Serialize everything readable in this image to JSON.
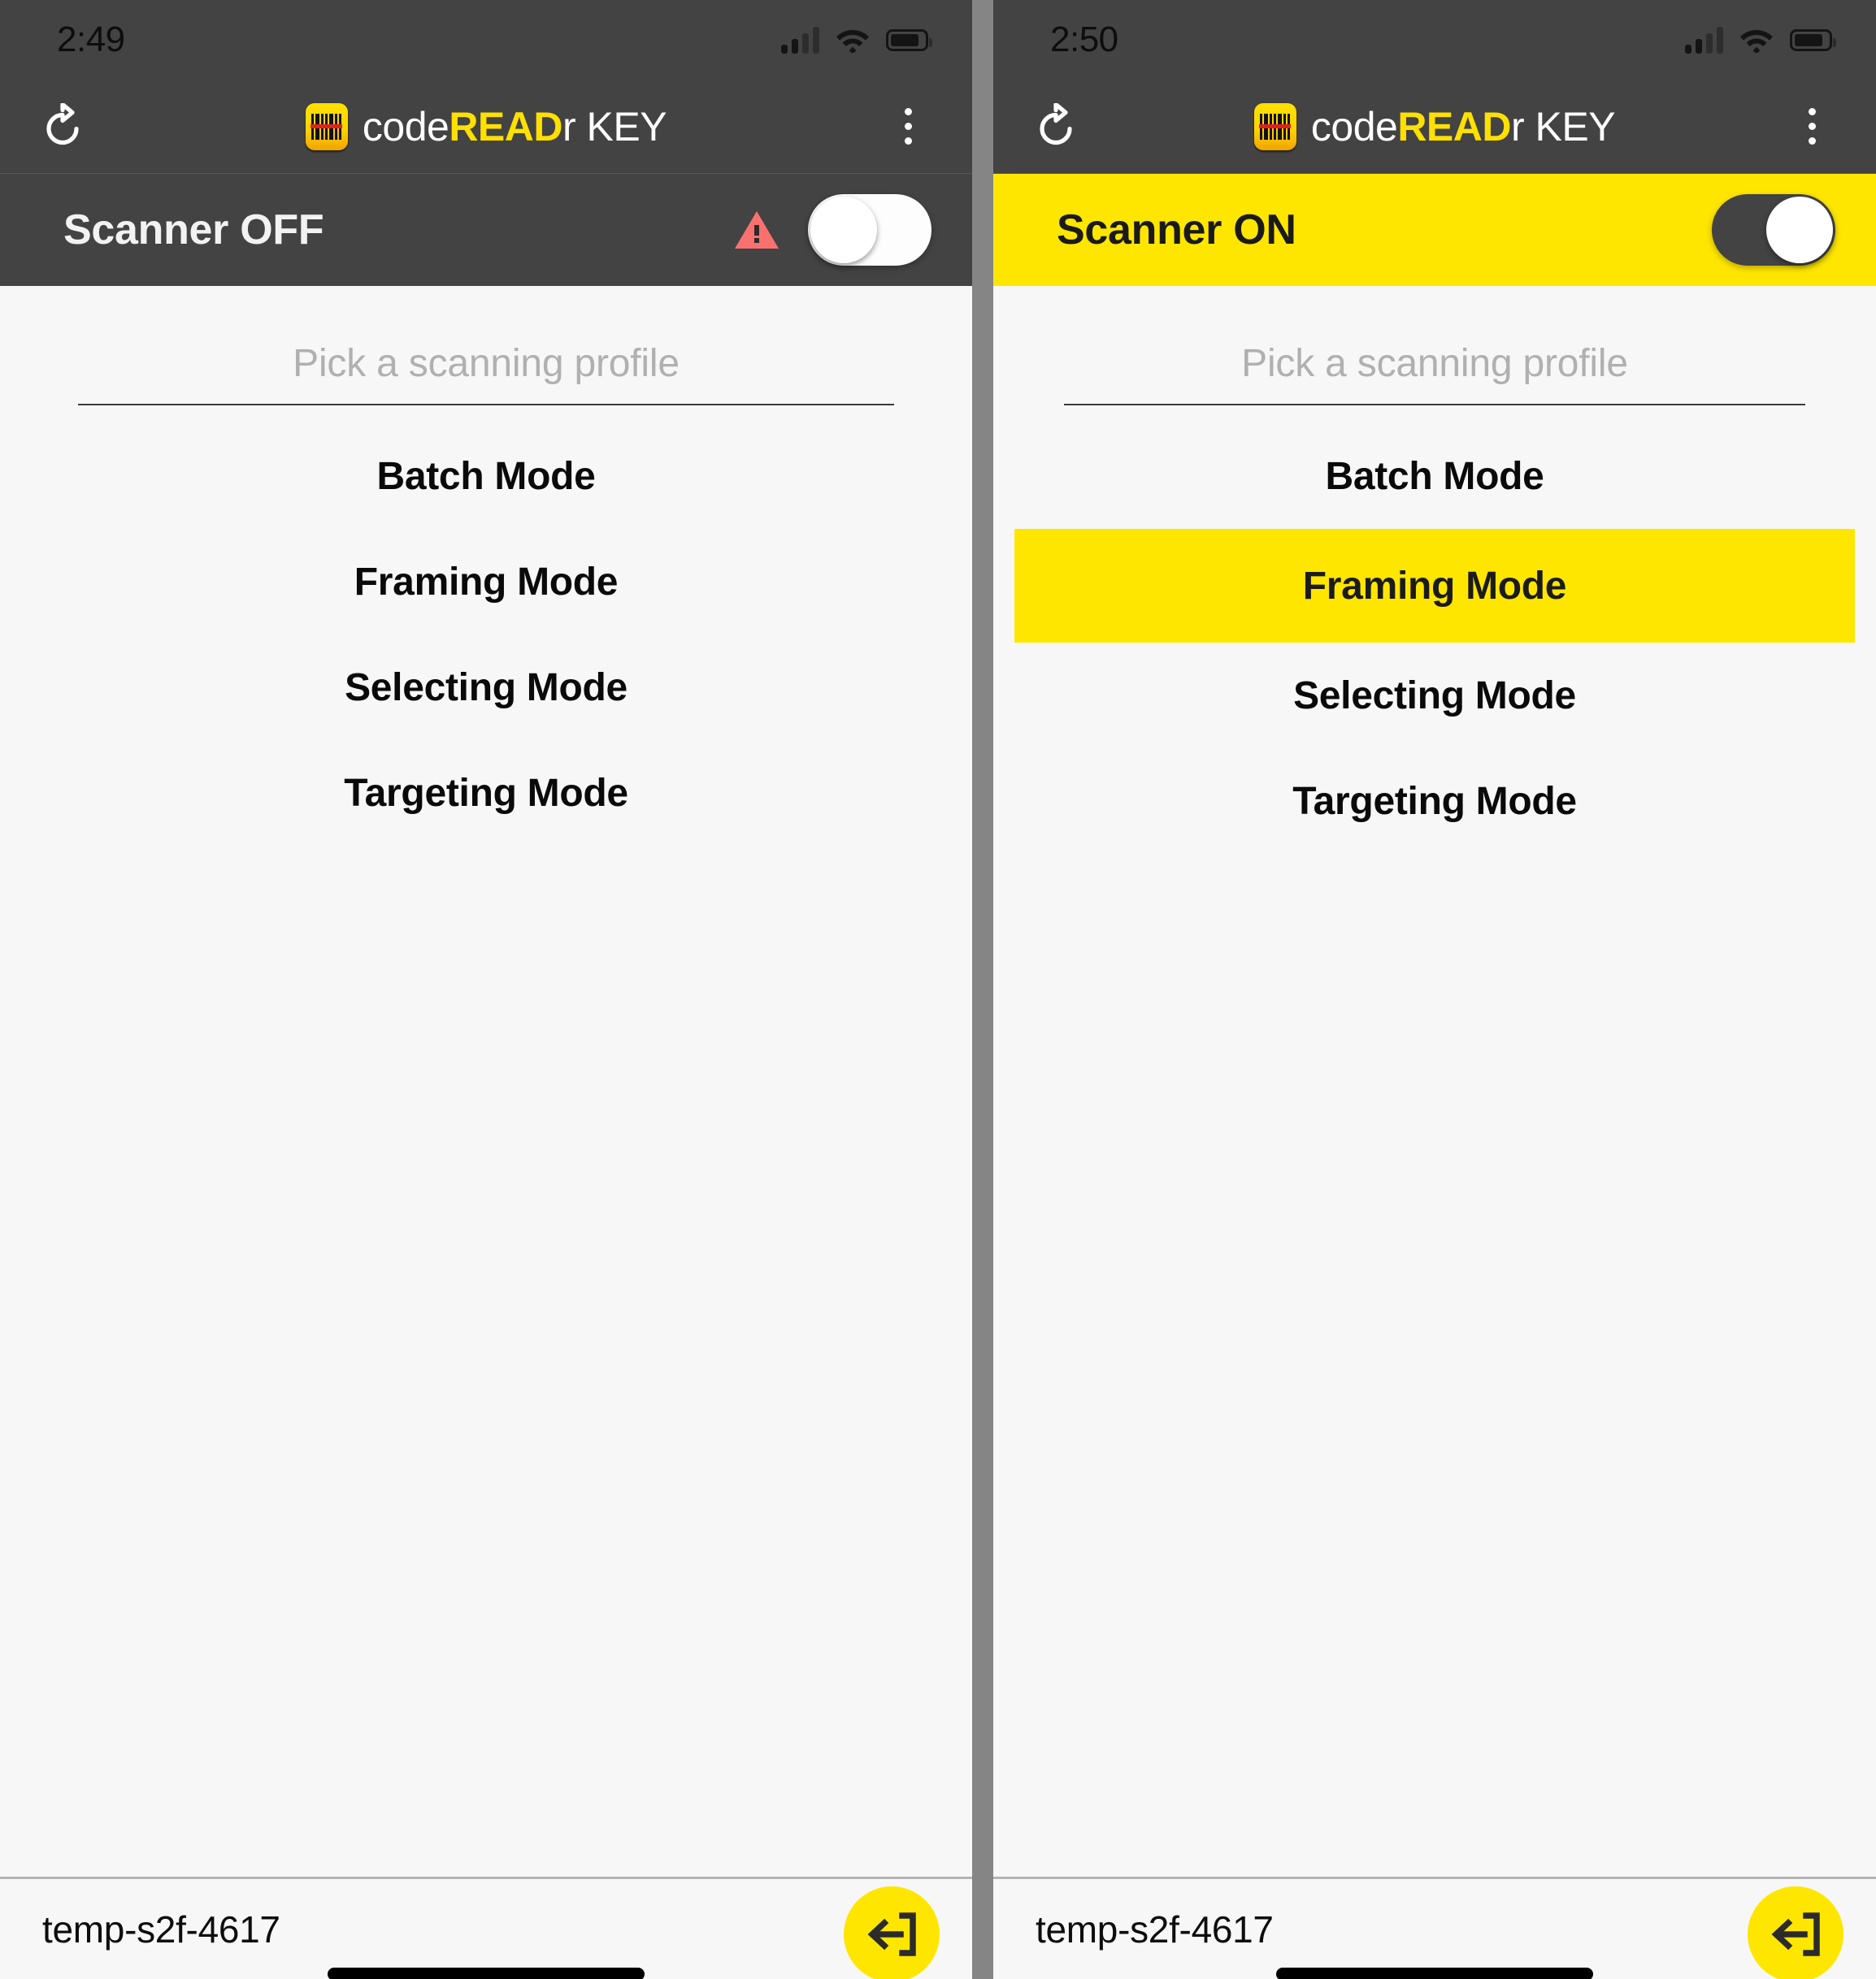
{
  "panels": [
    {
      "id": "left",
      "status": {
        "clock": "2:49",
        "signal_icon": "cellular-signal-icon",
        "wifi_icon": "wifi-icon",
        "battery_icon": "battery-icon"
      },
      "appbar": {
        "refresh_icon": "refresh-icon",
        "logo_icon": "barcode-app-logo-icon",
        "brand_prefix": "code",
        "brand_bold": "READ",
        "brand_suffix": "r KEY",
        "menu_icon": "kebab-menu-icon"
      },
      "scanner": {
        "label": "Scanner OFF",
        "state": "off",
        "warning_icon": "warning-triangle-icon",
        "warning_color": "#f9716f",
        "bar_bg": "#434343",
        "toggle_name": "scanner-toggle"
      },
      "profile": {
        "placeholder": "Pick a scanning profile",
        "value": ""
      },
      "modes": [
        {
          "label": "Batch Mode",
          "selected": false
        },
        {
          "label": "Framing Mode",
          "selected": false
        },
        {
          "label": "Selecting Mode",
          "selected": false
        },
        {
          "label": "Targeting Mode",
          "selected": false
        }
      ],
      "bottom": {
        "session_id": "temp-s2f-4617",
        "exit_icon": "exit-logout-icon",
        "exit_bg": "#ffe600"
      }
    },
    {
      "id": "right",
      "status": {
        "clock": "2:50",
        "signal_icon": "cellular-signal-icon",
        "wifi_icon": "wifi-icon",
        "battery_icon": "battery-icon"
      },
      "appbar": {
        "refresh_icon": "refresh-icon",
        "logo_icon": "barcode-app-logo-icon",
        "brand_prefix": "code",
        "brand_bold": "READ",
        "brand_suffix": "r KEY",
        "menu_icon": "kebab-menu-icon"
      },
      "scanner": {
        "label": "Scanner ON",
        "state": "on",
        "warning_icon": "",
        "warning_color": "",
        "bar_bg": "#ffe600",
        "toggle_name": "scanner-toggle"
      },
      "profile": {
        "placeholder": "Pick a scanning profile",
        "value": ""
      },
      "modes": [
        {
          "label": "Batch Mode",
          "selected": false
        },
        {
          "label": "Framing Mode",
          "selected": true
        },
        {
          "label": "Selecting Mode",
          "selected": false
        },
        {
          "label": "Targeting Mode",
          "selected": false
        }
      ],
      "bottom": {
        "session_id": "temp-s2f-4617",
        "exit_icon": "exit-logout-icon",
        "exit_bg": "#ffe600"
      }
    }
  ],
  "theme": {
    "brand_yellow": "#ffe600",
    "dark_bar": "#434343",
    "page_bg": "#f7f7f7",
    "gutter_gray": "#858585",
    "warning_red": "#f9716f"
  }
}
